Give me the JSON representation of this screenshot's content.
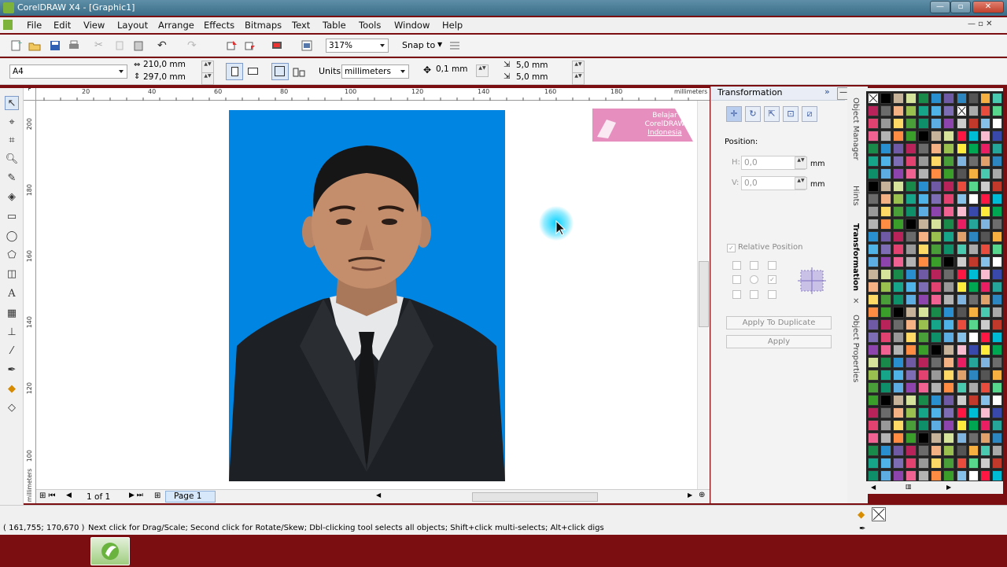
{
  "window": {
    "title": "CorelDRAW X4 - [Graphic1]"
  },
  "menu": [
    "File",
    "Edit",
    "View",
    "Layout",
    "Arrange",
    "Effects",
    "Bitmaps",
    "Text",
    "Table",
    "Tools",
    "Window",
    "Help"
  ],
  "toolbar": {
    "zoom": "317%",
    "snap_label": "Snap to"
  },
  "propertybar": {
    "page_size": "A4",
    "width": "210,0 mm",
    "height": "297,0 mm",
    "units_label": "Units:",
    "units": "millimeters",
    "nudge": "0,1 mm",
    "dup_x": "5,0 mm",
    "dup_y": "5,0 mm"
  },
  "ruler": {
    "units_label": "millimeters",
    "h_ticks": [
      "20",
      "40",
      "60",
      "80",
      "100",
      "120",
      "140",
      "160",
      "180"
    ],
    "v_ticks": [
      "200",
      "180",
      "160",
      "140",
      "120",
      "100"
    ]
  },
  "canvas": {
    "watermark_line1": "Belajar",
    "watermark_line2": "CorelDRAW",
    "watermark_line3": "Indonesia"
  },
  "page_nav": {
    "counter": "1 of 1",
    "page_tab": "Page 1"
  },
  "docker": {
    "title": "Transformation",
    "position_label": "Position:",
    "h_label": "H:",
    "h_value": "0,0",
    "v_label": "V:",
    "v_value": "0,0",
    "unit": "mm",
    "relative_label": "Relative Position",
    "apply_dup": "Apply To Duplicate",
    "apply": "Apply"
  },
  "vtabs": {
    "object_manager": "Object Manager",
    "hints": "Hints",
    "transformation": "Transformation",
    "object_properties": "Object Properties"
  },
  "status": {
    "coords": "( 161,755; 170,670 )",
    "message": "Next click for Drag/Scale; Second click for Rotate/Skew; Dbl-clicking tool selects all objects; Shift+click multi-selects; Alt+click digs"
  },
  "colors": {
    "photo_bg": "#0085e3",
    "highlight": "#00d0ff",
    "watermark": "#e68fbf"
  }
}
